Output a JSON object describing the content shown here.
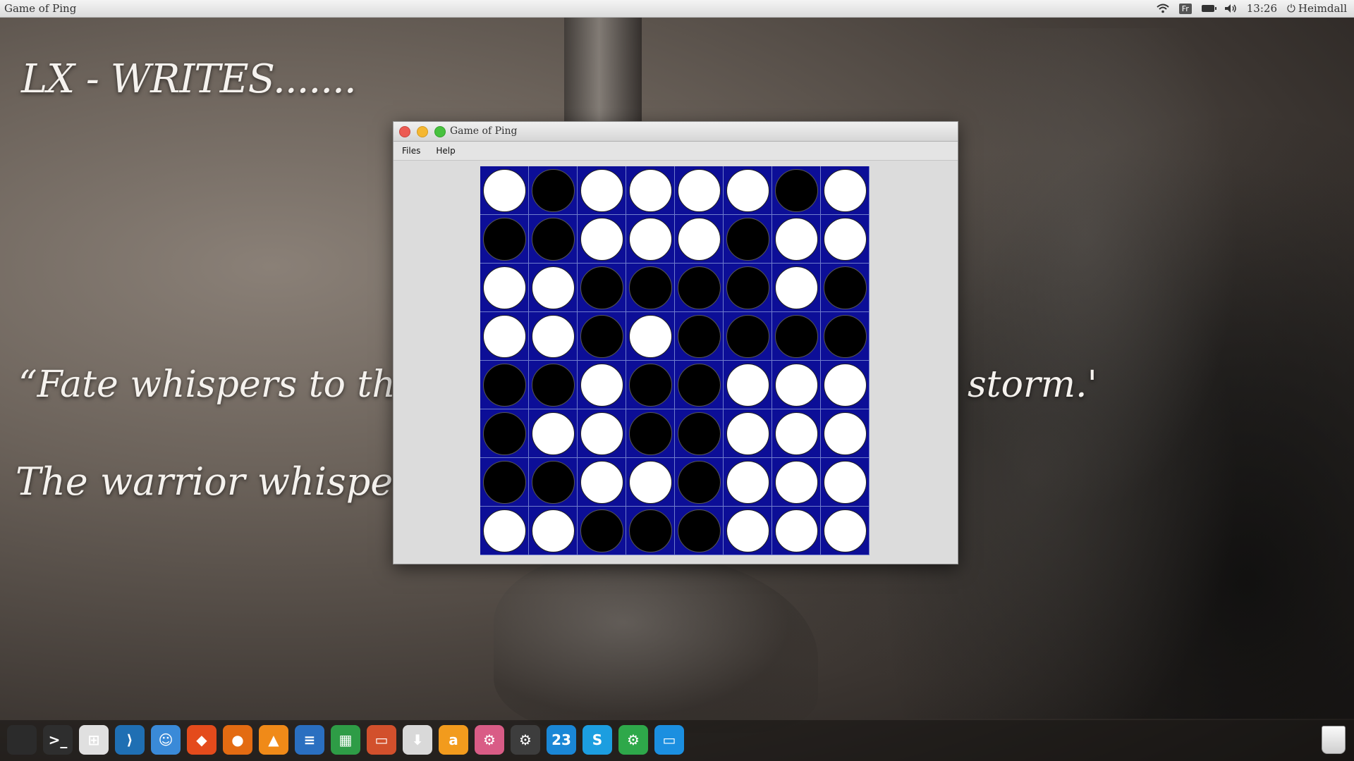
{
  "top_bar": {
    "app_title": "Game of Ping",
    "language": "Fr",
    "clock": "13:26",
    "user": "Heimdall"
  },
  "wallpaper": {
    "title": "LX - WRITES.......",
    "quote_start": "“Fate whispers to the w",
    "quote_end": "storm.'",
    "line2": "The warrior whispers b"
  },
  "window": {
    "title": "Game of Ping",
    "menu": [
      "Files",
      "Help"
    ]
  },
  "board": {
    "size": 8,
    "rows": [
      "WBWWWWBW",
      "BBWWWBWW",
      "WWBBBBWB",
      "WWBWBBBB",
      "BBWBBWWW",
      "BWWBBWWW",
      "BBWWBWWW",
      "WWBBBWWW"
    ],
    "colors": {
      "board": "#0c0e97",
      "white": "#ffffff",
      "black": "#000000"
    }
  },
  "dock": {
    "icons": [
      {
        "name": "apple-icon",
        "color": "#2b2b2b",
        "glyph": ""
      },
      {
        "name": "terminal-icon",
        "color": "#2e2e2e",
        "glyph": ">_"
      },
      {
        "name": "windows-icon",
        "color": "#e0e0e0",
        "glyph": "⊞"
      },
      {
        "name": "vscode-icon",
        "color": "#1f6fb3",
        "glyph": "⟩"
      },
      {
        "name": "finder-icon",
        "color": "#3a8ad8",
        "glyph": "☺"
      },
      {
        "name": "brave-icon",
        "color": "#e44b1c",
        "glyph": "◆"
      },
      {
        "name": "firefox-icon",
        "color": "#e36b12",
        "glyph": "●"
      },
      {
        "name": "vlc-icon",
        "color": "#f08a18",
        "glyph": "▲"
      },
      {
        "name": "writer-icon",
        "color": "#2a6fc0",
        "glyph": "≡"
      },
      {
        "name": "calc-icon",
        "color": "#2e9c46",
        "glyph": "▦"
      },
      {
        "name": "impress-icon",
        "color": "#d2502c",
        "glyph": "▭"
      },
      {
        "name": "installer-icon",
        "color": "#d9d9d9",
        "glyph": "⬇"
      },
      {
        "name": "amazon-icon",
        "color": "#f29b1d",
        "glyph": "a"
      },
      {
        "name": "settings-pink-icon",
        "color": "#d95c86",
        "glyph": "⚙"
      },
      {
        "name": "system-settings-icon",
        "color": "#3d3d3d",
        "glyph": "⚙"
      },
      {
        "name": "calendar-icon",
        "color": "#1a87d6",
        "glyph": "23"
      },
      {
        "name": "skype-icon",
        "color": "#1c9ee0",
        "glyph": "S"
      },
      {
        "name": "gear-green-icon",
        "color": "#2ea84a",
        "glyph": "⚙"
      },
      {
        "name": "mail-icon",
        "color": "#1b8fe0",
        "glyph": "▭"
      }
    ]
  }
}
